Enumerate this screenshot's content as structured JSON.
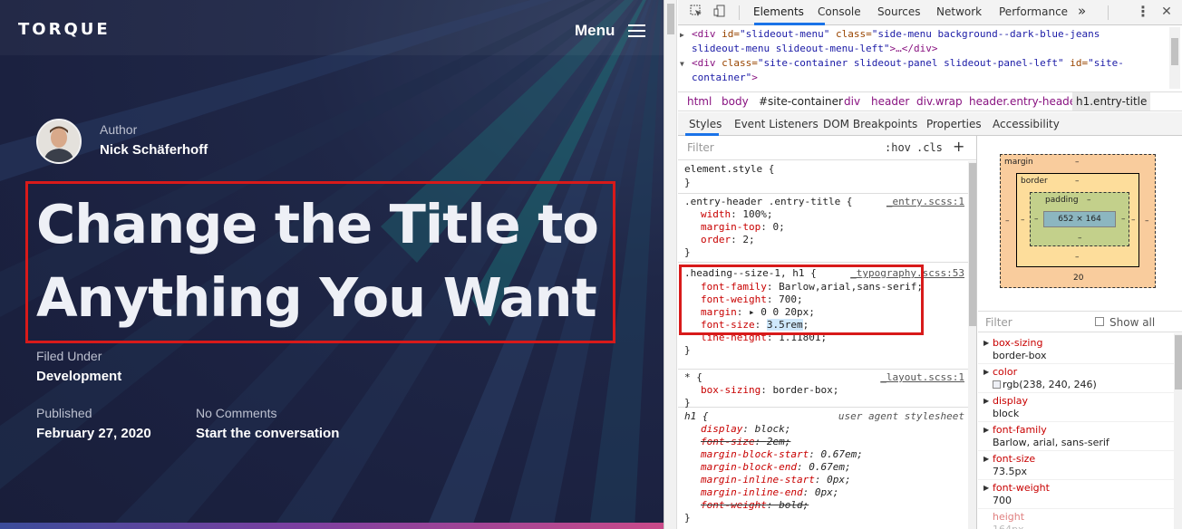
{
  "site": {
    "logo": "TORQUE",
    "menu_label": "Menu",
    "author_label": "Author",
    "author_name": "Nick Schäferhoff",
    "title_line1": "Change the Title to",
    "title_line2": "Anything You Want",
    "filed_label": "Filed Under",
    "filed_value": "Development",
    "published_label": "Published",
    "published_value": "February 27, 2020",
    "comments_label": "No Comments",
    "comments_value": "Start the conversation"
  },
  "devtools": {
    "tabs": [
      "Elements",
      "Console",
      "Sources",
      "Network",
      "Performance"
    ],
    "more_tabs": "»",
    "html_lines": {
      "l1_tag_open": "<div ",
      "l1_attr1": "id=",
      "l1_val1": "\"slideout-menu\"",
      "l1_attr2": " class=",
      "l1_val2": "\"side-menu background--dark-blue-jeans",
      "l2_val": "slideout-menu slideout-menu-left\"",
      "l2_close": ">…</div>",
      "l3_tag_open": "<div ",
      "l3_attr1": "class=",
      "l3_val1": "\"site-container slideout-panel slideout-panel-left\"",
      "l3_attr2": " id=",
      "l3_val2": "\"site-",
      "l4_val": "container\"",
      "l4_close": ">"
    },
    "breadcrumbs": [
      "html",
      "body",
      "#site-container",
      "div",
      "header",
      "div.wrap",
      "header.entry-header",
      "h1.entry-title"
    ],
    "subtabs": [
      "Styles",
      "Event Listeners",
      "DOM Breakpoints",
      "Properties",
      "Accessibility"
    ],
    "styles": {
      "filter_placeholder": "Filter",
      "hov": ":hov",
      "cls": ".cls",
      "plus": "+",
      "rules": [
        {
          "selector": "element.style {",
          "source": "",
          "decls": [],
          "close": "}"
        },
        {
          "selector": ".entry-header .entry-title {",
          "source": "_entry.scss:1",
          "decls": [
            {
              "p": "width",
              "v": "100%;"
            },
            {
              "p": "margin-top",
              "v": "0;"
            },
            {
              "p": "order",
              "v": "2;"
            }
          ],
          "close": "}"
        },
        {
          "selector": ".heading--size-1, h1 {",
          "source": "_typography.scss:53",
          "decls": [
            {
              "p": "font-family",
              "v": "Barlow,arial,sans-serif;"
            },
            {
              "p": "font-weight",
              "v": "700;"
            },
            {
              "p": "margin",
              "v": "▸ 0 0 20px;"
            },
            {
              "p": "font-size",
              "v": "3.5rem",
              "after": ";"
            },
            {
              "p": "line-height",
              "v": "1.11801;"
            }
          ],
          "close": "}"
        },
        {
          "selector": "* {",
          "source": "_layout.scss:1",
          "decls": [
            {
              "p": "box-sizing",
              "v": "border-box;"
            }
          ],
          "close": "}"
        },
        {
          "selector": "h1 {",
          "source": "user agent stylesheet",
          "decls": [
            {
              "p": "display",
              "v": "block;"
            },
            {
              "p": "font-size",
              "v": "2em;"
            },
            {
              "p": "margin-block-start",
              "v": "0.67em;"
            },
            {
              "p": "margin-block-end",
              "v": "0.67em;"
            },
            {
              "p": "margin-inline-start",
              "v": "0px;"
            },
            {
              "p": "margin-inline-end",
              "v": "0px;"
            },
            {
              "p": "font-weight",
              "v": "bold;"
            }
          ],
          "close": "}"
        }
      ]
    },
    "box_model": {
      "margin_label": "margin",
      "border_label": "border",
      "padding_label": "padding",
      "content_size": "652 × 164",
      "dash": "–",
      "margin_bottom": "20"
    },
    "computed": {
      "filter_placeholder": "Filter",
      "show_all": "Show all",
      "rows": [
        {
          "p": "box-sizing",
          "v": "border-box"
        },
        {
          "p": "color",
          "v": "rgb(238, 240, 246)",
          "swatch": "#eef0f6"
        },
        {
          "p": "display",
          "v": "block"
        },
        {
          "p": "font-family",
          "v": "Barlow, arial, sans-serif"
        },
        {
          "p": "font-size",
          "v": "73.5px"
        },
        {
          "p": "font-weight",
          "v": "700"
        },
        {
          "p": "height",
          "v": "164px"
        }
      ]
    }
  },
  "colors": {
    "highlight_red": "#d81a1a",
    "page_bg": "#1b2140",
    "devtools_accent": "#1a73e8"
  }
}
